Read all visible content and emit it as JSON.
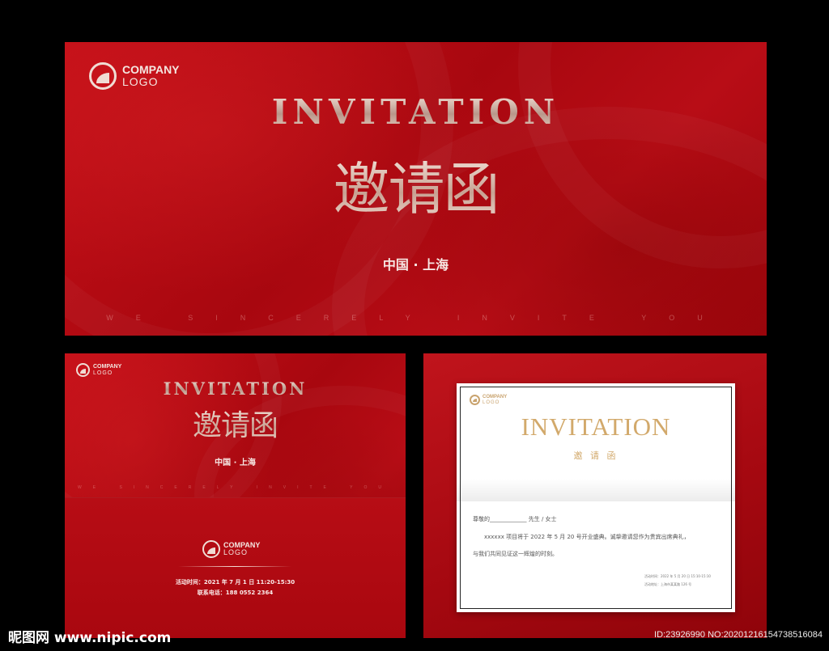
{
  "top_card": {
    "logo_line1": "COMPANY",
    "logo_line2": "LOGO",
    "title_en": "INVITATION",
    "title_cn": "邀请函",
    "location": "中国 · 上海",
    "slogan": "WE SINCERELY INVITE YOU"
  },
  "bottom_left": {
    "logo_line1": "COMPANY",
    "logo_line2": "LOGO",
    "title_en": "INVITATION",
    "title_cn": "邀请函",
    "location": "中国 · 上海",
    "slogan": "WE SINCERELY INVITE YOU",
    "back_logo_line1": "COMPANY",
    "back_logo_line2": "LOGO",
    "event_time": "活动时间：2021 年 7 月 1 日 11:20-15:30",
    "phone": "联系电话：188 0552 2364"
  },
  "bottom_right": {
    "logo_line1": "COMPANY",
    "logo_line2": "LOGO",
    "title_en": "INVITATION",
    "title_cn": "邀 请 函",
    "salutation": "尊敬的_____________  先生 / 女士",
    "body1": "xxxxxx 项目将于 2022 年 5 月 20 号开业盛典。诚挚邀请您作为贵宾出席典礼，",
    "body2": "与我们共同见证这一辉煌的时刻。",
    "detail_time": "活动时间：2022 年 5 月 20 日 15:10-15:10",
    "detail_address": "活动地址：上海市某某路 126 号"
  },
  "watermark": {
    "left": "昵图网 www.nipic.com",
    "right": "ID:23926990 NO:20201216154738516084"
  }
}
